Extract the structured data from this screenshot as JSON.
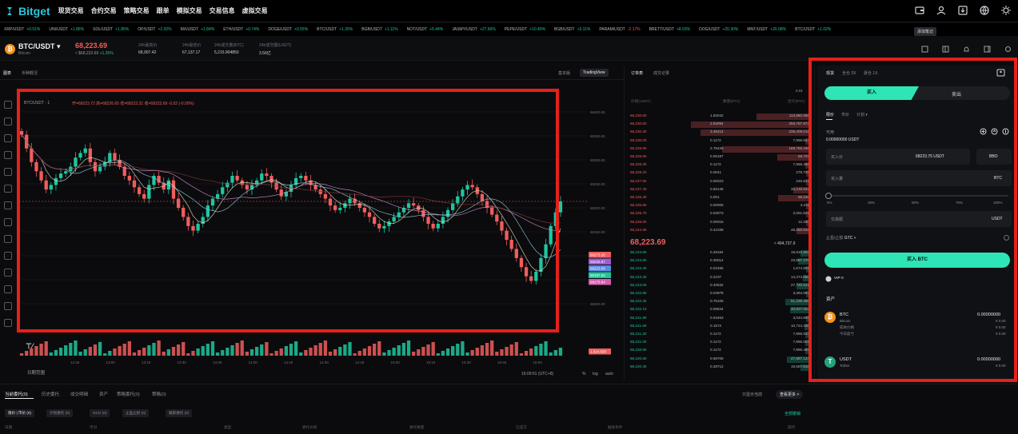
{
  "nav": {
    "brand": "Bitget",
    "items": [
      "现货交易",
      "合约交易",
      "策略交易",
      "跟单",
      "模拟交易",
      "交易信息",
      "虚拟交易"
    ]
  },
  "ticker": [
    {
      "sym": "XRP/USDT",
      "chg": "+0.51%",
      "dir": "up"
    },
    {
      "sym": "UNI/USDT",
      "chg": "+1.86%",
      "dir": "up"
    },
    {
      "sym": "SOL/USDT",
      "chg": "+1.85%",
      "dir": "up"
    },
    {
      "sym": "OP/USDT",
      "chg": "+2.92%",
      "dir": "up"
    },
    {
      "sym": "MX/USDT",
      "chg": "+1.84%",
      "dir": "up"
    },
    {
      "sym": "ETH/USDT",
      "chg": "+0.74%",
      "dir": "up"
    },
    {
      "sym": "DOGE/USDT",
      "chg": "+0.55%",
      "dir": "up"
    },
    {
      "sym": "BTC/USDT",
      "chg": "+1.25%",
      "dir": "up"
    },
    {
      "sym": "BGB/USDT",
      "chg": "+1.11%",
      "dir": "up"
    },
    {
      "sym": "NOT/USDT",
      "chg": "+5.44%",
      "dir": "up"
    },
    {
      "sym": "JASMY/USDT",
      "chg": "+27.66%",
      "dir": "up"
    },
    {
      "sym": "PEPE/USDT",
      "chg": "+10.40%",
      "dir": "up"
    },
    {
      "sym": "BGB/USDT",
      "chg": "+3.11%",
      "dir": "up"
    },
    {
      "sym": "PARAM/USDT",
      "chg": "-2.17%",
      "dir": "down"
    },
    {
      "sym": "BRETT/USDT",
      "chg": "+8.03%",
      "dir": "up"
    },
    {
      "sym": "DOG/USDT",
      "chg": "+20.30%",
      "dir": "up"
    },
    {
      "sym": "MNT/USDT",
      "chg": "+20.08%",
      "dir": "up"
    },
    {
      "sym": "BTC/USDT",
      "chg": "+1.02%",
      "dir": "up"
    }
  ],
  "tooltip": "添加笔记",
  "pair": {
    "name": "BTC/USDT",
    "sub": "Bitcoin",
    "price": "68,223.69",
    "sub_price": "≈ $68,223.69",
    "change": "+1.25%",
    "stats": [
      {
        "label": "24h最高价",
        "value": "68,907.42"
      },
      {
        "label": "24h最低价",
        "value": "67,137.17"
      },
      {
        "label": "24h成交量(BTC)",
        "value": "5,215.904850"
      },
      {
        "label": "24h成交额(USDT)",
        "value": "3.56亿"
      }
    ]
  },
  "chart": {
    "tabs": [
      "图表",
      "币种概况"
    ],
    "right_tabs": [
      "基本版",
      "TradingView"
    ],
    "title": "BTC/USDT · 1",
    "ohlc": "开=68223.72 高=68226.65 低=68222.31 收=68223.69 -0.02 (-0.00%)",
    "price_labels": [
      "68273.20",
      "68226.87",
      "68223.69",
      "68187.54",
      "68175.84"
    ],
    "axis_ticks": [
      "68400.00",
      "68350.00",
      "68300.00",
      "68250.00",
      "68200.00",
      "68150.00",
      "68100.00",
      "68050.00",
      "68000.00"
    ],
    "vol_label": "1,024,500",
    "time_ticks": [
      "12:45",
      "13:00",
      "13:15",
      "13:30",
      "13:45",
      "14:00",
      "14:15",
      "14:30",
      "14:45",
      "15:00",
      "15:15",
      "15:30",
      "15:45",
      "16:00"
    ],
    "footer_left": "日期范围",
    "footer_time": "16:09:51 (UTC+8)",
    "footer_pct": "%",
    "footer_log": "log",
    "footer_auto": "auto"
  },
  "chart_data": {
    "type": "candlestick",
    "x_start": "12:30",
    "x_end": "16:10",
    "ylim": [
      68000,
      68420
    ],
    "close": [
      68370,
      68340,
      68310,
      68290,
      68270,
      68250,
      68260,
      68275,
      68285,
      68290,
      68300,
      68320,
      68330,
      68340,
      68310,
      68290,
      68300,
      68310,
      68330,
      68315,
      68300,
      68280,
      68270,
      68255,
      68240,
      68230,
      68260,
      68280,
      68265,
      68250,
      68270,
      68230,
      68210,
      68190,
      68170,
      68160,
      68175,
      68190,
      68215,
      68230,
      68240,
      68255,
      68265,
      68280,
      68270,
      68260,
      68250,
      68260,
      68270,
      68285,
      68280,
      68265,
      68250,
      68235,
      68245,
      68260,
      68275,
      68280,
      68270,
      68260,
      68250,
      68240,
      68230,
      68215,
      68205,
      68210,
      68220,
      68230,
      68220,
      68210,
      68200,
      68190,
      68175,
      68165,
      68170,
      68180,
      68190,
      68200,
      68210,
      68220,
      68215,
      68205,
      68190,
      68175,
      68165,
      68175,
      68190,
      68205,
      68220,
      68235,
      68250,
      68260,
      68255,
      68240,
      68225,
      68210,
      68195,
      68180,
      68160,
      68140,
      68120,
      68100,
      68080,
      68060,
      68050,
      68070,
      68100,
      68130,
      68170,
      68200,
      68224
    ]
  },
  "orderbook": {
    "tabs": [
      "订单表",
      "成交记录"
    ],
    "cols": [
      "价格(USDT)",
      "数量(BTC)",
      "合计(BTC)"
    ],
    "step": "0.01",
    "asks": [
      {
        "p": "68,230.60",
        "a": "1.82042",
        "t": "113,960.066"
      },
      {
        "p": "68,230.50",
        "a": "2.84094",
        "t": "255,787.972"
      },
      {
        "p": "68,230.30",
        "a": "3.46414",
        "t": "236,409.015"
      },
      {
        "p": "68,230.00",
        "a": "0.1172",
        "t": "7,996.544"
      },
      {
        "p": "68,229.80",
        "a": "2.78426",
        "t": "189,765.186"
      },
      {
        "p": "68,228.90",
        "a": "0.00187",
        "t": "68,707"
      },
      {
        "p": "68,228.30",
        "a": "0.1172",
        "t": "7,996.466"
      },
      {
        "p": "68,228.20",
        "a": "0.0041",
        "t": "279.736"
      },
      {
        "p": "68,227.90",
        "a": "0.00023",
        "t": "245.521"
      },
      {
        "p": "68,227.40",
        "a": "0.50148",
        "t": "34,219.022"
      },
      {
        "p": "68,226.40",
        "a": "0.001",
        "t": "68,226"
      },
      {
        "p": "68,225.80",
        "a": "0.00005",
        "t": "3.411"
      },
      {
        "p": "68,225.70",
        "a": "0.03073",
        "t": "2,061.521"
      },
      {
        "p": "68,225.00",
        "a": "0.00018",
        "t": "12.280"
      },
      {
        "p": "68,224.30",
        "a": "0.41039",
        "t": "28,250.532"
      }
    ],
    "mid": "68,223.69",
    "mid_usd": "≈ 494,737.9",
    "bids": [
      {
        "p": "68,223.69",
        "a": "0.29184",
        "t": "19,910.802"
      },
      {
        "p": "68,223.60",
        "a": "0.35014",
        "t": "23,887.376"
      },
      {
        "p": "68,223.40",
        "a": "0.02455",
        "t": "1,674.891"
      },
      {
        "p": "68,223.30",
        "a": "0.2107",
        "t": "14,374.650"
      },
      {
        "p": "68,223.00",
        "a": "0.40632",
        "t": "27,720.541"
      },
      {
        "p": "68,222.80",
        "a": "0.04978",
        "t": "3,394.087"
      },
      {
        "p": "68,222.30",
        "a": "0.75106",
        "t": "51,238.466"
      },
      {
        "p": "68,222.10",
        "a": "0.59844",
        "t": "40,827.063"
      },
      {
        "p": "68,221.80",
        "a": "0.04463",
        "t": "3,044.869"
      },
      {
        "p": "68,221.60",
        "a": "0.1572",
        "t": "10,724.436"
      },
      {
        "p": "68,221.30",
        "a": "0.1172",
        "t": "7,995.537"
      },
      {
        "p": "68,221.00",
        "a": "0.1172",
        "t": "7,995.501"
      },
      {
        "p": "68,220.90",
        "a": "0.1172",
        "t": "7,995.489"
      },
      {
        "p": "68,220.60",
        "a": "0.68709",
        "t": "47,867.124"
      },
      {
        "p": "68,220.30",
        "a": "0.28712",
        "t": "19,587.816"
      }
    ]
  },
  "trade": {
    "tabs": [
      "现货",
      "全仓 3X",
      "逐仓 1X"
    ],
    "buy": "买入",
    "sell": "卖出",
    "types": [
      "限价",
      "市价",
      "计划"
    ],
    "available_label": "可用",
    "available": "0.00000000 USDT",
    "price_label": "买入价",
    "price": "68223.75 USDT",
    "bbo": "BBO",
    "qty_label": "买入量",
    "qty_unit": "BTC",
    "slider_marks": [
      "0%",
      "25%",
      "50%",
      "75%",
      "100%"
    ],
    "amount_label": "交易额",
    "amount_unit": "USDT",
    "tpsl": "止盈/止损",
    "gtc": "GTC",
    "submit": "买入 BTC",
    "vip": "VIP 0",
    "assets_title": "资产",
    "assets": [
      {
        "sym": "BTC",
        "name": "Bitcoin",
        "amount": "0.00000000",
        "usd": "¥ 0.00",
        "rows": [
          {
            "l": "成本价格",
            "v": "¥ 0.00"
          },
          {
            "l": "今日盈亏",
            "v": "¥ 0.00"
          }
        ]
      },
      {
        "sym": "USDT",
        "name": "Tether",
        "amount": "0.00000000",
        "usd": "¥ 0.00",
        "rows": []
      }
    ],
    "deposit": "充值",
    "transfer": "划转"
  },
  "bottom": {
    "tabs": [
      "当前委托(0)",
      "历史委托",
      "成交明细",
      "资产",
      "策略委托(0)",
      "策略(0)"
    ],
    "pills": [
      "限价 | 市价 (0)",
      "计划委托 (0)",
      "OCO (0)",
      "止盈止损 (0)",
      "跟踪委托 (0)"
    ],
    "only_current": "只显示当前",
    "view_more": "查看更多 >",
    "cancel_all": "全部撤销",
    "cols": [
      "日期",
      "币对",
      "类型",
      "委托价格",
      "委托数量",
      "已成交",
      "触发条件",
      "操作"
    ]
  },
  "colors": {
    "up": "#20c59e",
    "down": "#f05d5d",
    "accent": "#2ee6b5",
    "highlight": "#e6201b"
  }
}
